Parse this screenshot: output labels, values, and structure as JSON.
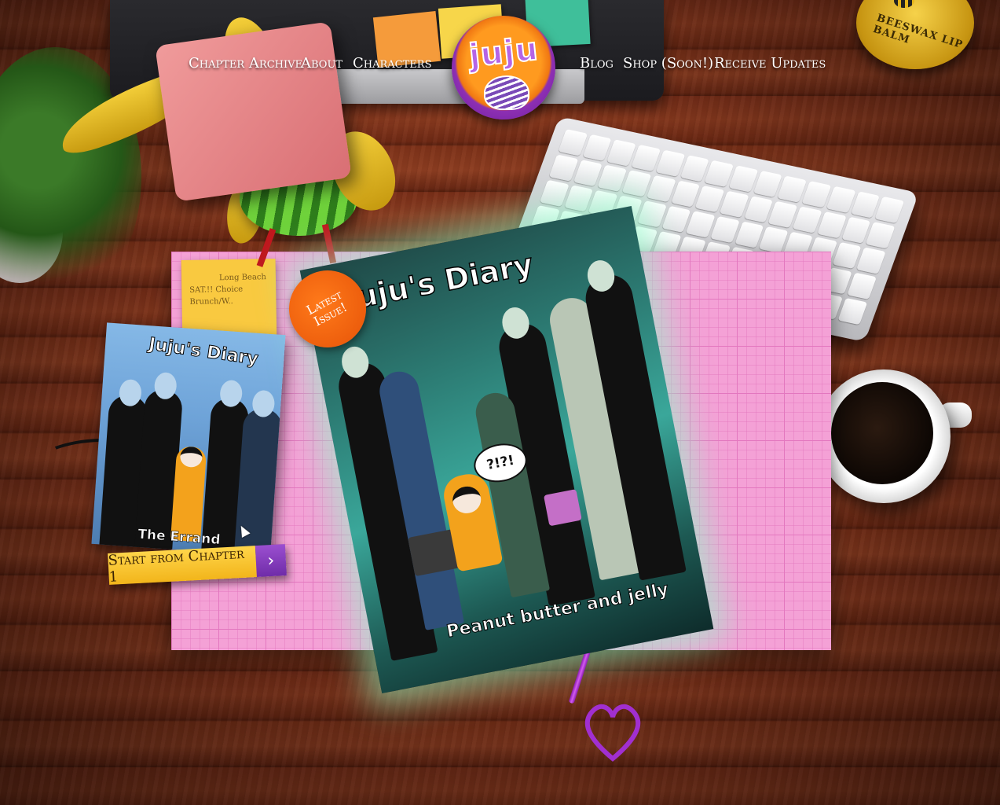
{
  "nav": {
    "left": [
      {
        "label": "Chapter Archive"
      },
      {
        "label": "About"
      },
      {
        "label": "Characters"
      }
    ],
    "right": [
      {
        "label": "Blog"
      },
      {
        "label": "Shop (Soon!)"
      },
      {
        "label": "Receive Updates"
      }
    ],
    "logo_text": "juju"
  },
  "desk": {
    "lip_balm_label": "BEESWAX LIP BALM",
    "sticky_note_lines": [
      "Long Beach",
      "SAT.!! Choice",
      "Brunch/W.."
    ]
  },
  "first_chapter": {
    "cover_title": "Juju's Diary",
    "cover_subtitle": "The Errand",
    "button_label": "Start from Chapter 1",
    "button_arrow": "›"
  },
  "latest_issue": {
    "badge_label": "Latest Issue!",
    "cover_title": "Juju's Diary",
    "cover_subtitle": "Peanut butter and jelly",
    "thought_bubble": "?!?!"
  },
  "colors": {
    "mat_pink": "#f4a1d6",
    "badge_orange": "#e65308",
    "button_yellow": "#f2b51b",
    "button_purple": "#6f2ca8",
    "logo_purple": "#6a1d9d"
  }
}
